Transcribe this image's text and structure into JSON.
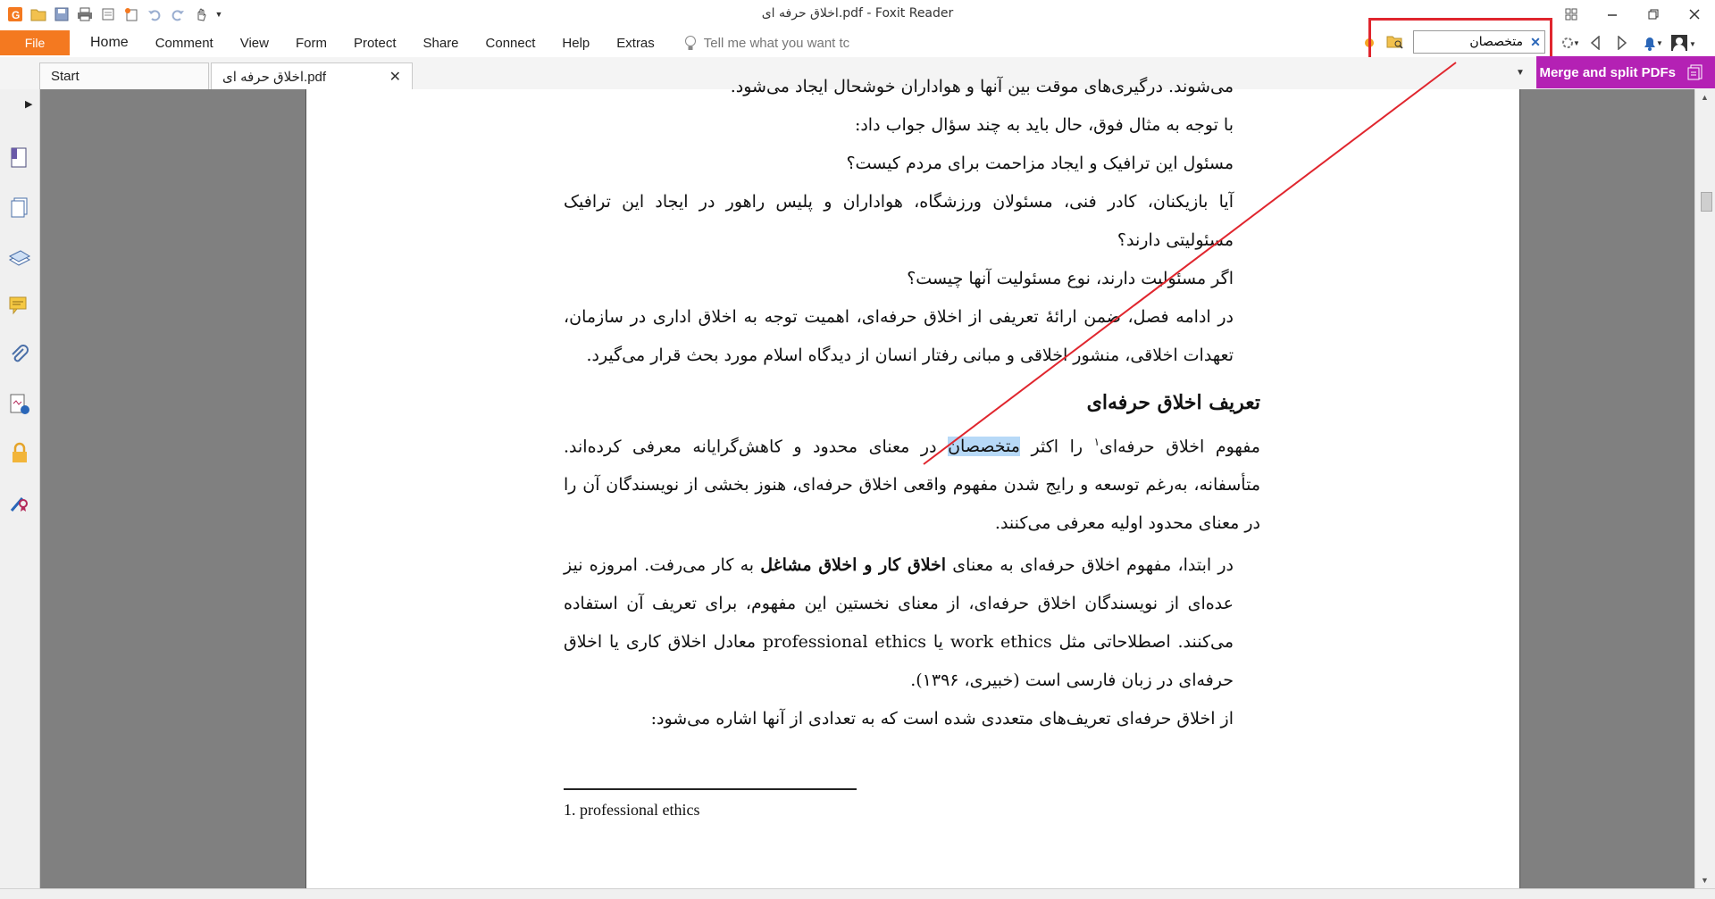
{
  "window": {
    "title": "اخلاق حرفه ای.pdf - Foxit Reader"
  },
  "menu": {
    "file": "File",
    "items": [
      "Home",
      "Comment",
      "View",
      "Form",
      "Protect",
      "Share",
      "Connect",
      "Help",
      "Extras"
    ],
    "tell_me": "Tell me what you want tc"
  },
  "search": {
    "value": "متخصصان"
  },
  "tabs": {
    "start": "Start",
    "doc": "اخلاق حرفه ای.pdf"
  },
  "promo": {
    "label": "Merge and split PDFs"
  },
  "document": {
    "top_cut": "می‌شوند. درگیری‌های موقت بین آنها و هواداران خوشحال ایجاد می‌شود.",
    "p1": "با توجه به مثال فوق، حال باید به چند سؤال جواب داد:",
    "p2": "مسئول این ترافیک و ایجاد مزاحمت برای مردم کیست؟",
    "p3": "آیا بازیکنان، کادر فنی، مسئولان ورزشگاه، هواداران و پلیس راهور در ایجاد این ترافیک مسئولیتی دارند؟",
    "p4": "اگر مسئولیت دارند، نوع مسئولیت آنها چیست؟",
    "p5": "در ادامه فصل، ضمن ارائهٔ تعریفی از اخلاق حرفه‌ای، اهمیت توجه به اخلاق اداری در سازمان، تعهدات اخلاقی، منشور اخلاقی و مبانی رفتار انسان از دیدگاه اسلام مورد بحث قرار می‌گیرد.",
    "heading": "تعریف اخلاق حرفه‌ای",
    "p6_before": "مفهوم اخلاق حرفه‌ای",
    "p6_sup": "۱",
    "p6_mid": " را اکثر ",
    "p6_highlight": "متخصصان",
    "p6_after": " در معنای محدود و کاهش‌گرایانه معرفی کرده‌اند. متأسفانه، به‌رغم توسعه و رایج شدن مفهوم واقعی اخلاق حرفه‌ای، هنوز بخشی از نویسندگان آن را در معنای محدود اولیه معرفی می‌کنند.",
    "p7_before": "در ابتدا، مفهوم اخلاق حرفه‌ای به معنای ",
    "p7_bold": "اخلاق کار و اخلاق مشاغل",
    "p7_after": " به کار می‌رفت. امروزه نیز عده‌ای از نویسندگان اخلاق حرفه‌ای، از معنای نخستین این مفهوم، برای تعریف آن استفاده می‌کنند. اصطلاحاتی مثل work ethics یا professional ethics معادل اخلاق کاری یا اخلاق حرفه‌ای در زبان فارسی است (خبیری، ۱۳۹۶).",
    "p8": "از اخلاق حرفه‌ای تعریف‌های متعددی شده است که به تعدادی از آنها اشاره می‌شود:",
    "footnote": "1. professional ethics"
  },
  "colors": {
    "file_orange": "#f47920",
    "promo_purple": "#b421b4",
    "annotation_red": "#e0262e",
    "highlight_blue": "#b7d9f7"
  }
}
